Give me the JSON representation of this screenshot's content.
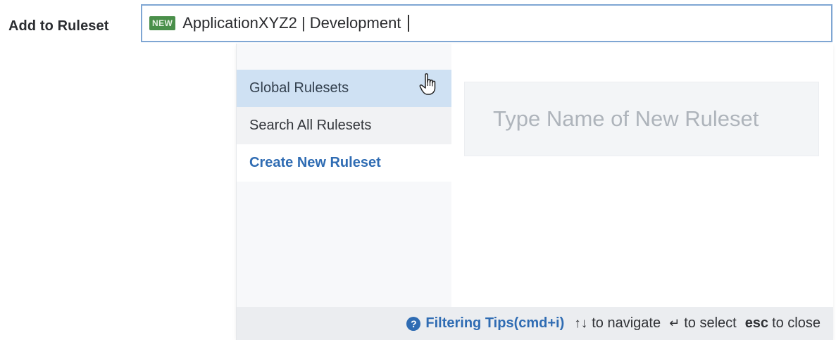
{
  "field": {
    "label": "Add to Ruleset",
    "badge": "NEW",
    "value": "ApplicationXYZ2 | Development"
  },
  "menu": {
    "items": [
      {
        "label": "Global Rulesets",
        "state": "hovered"
      },
      {
        "label": "Search All Rulesets",
        "state": "default"
      },
      {
        "label": "Create New Ruleset",
        "state": "active"
      }
    ]
  },
  "new_ruleset": {
    "placeholder": "Type Name of New Ruleset"
  },
  "footer": {
    "tips_label": "Filtering Tips(cmd+i)",
    "navigate_hint": "to navigate",
    "select_hint": "to select",
    "esc_key": "esc",
    "close_hint": "to close"
  },
  "colors": {
    "accent": "#2f6cb3",
    "badge": "#4a8f4a",
    "hover": "#cfe1f3",
    "input_border": "#7fa6d3"
  },
  "icons": [
    "help-icon",
    "arrows-up-down-icon",
    "enter-icon",
    "hand-cursor-icon"
  ]
}
